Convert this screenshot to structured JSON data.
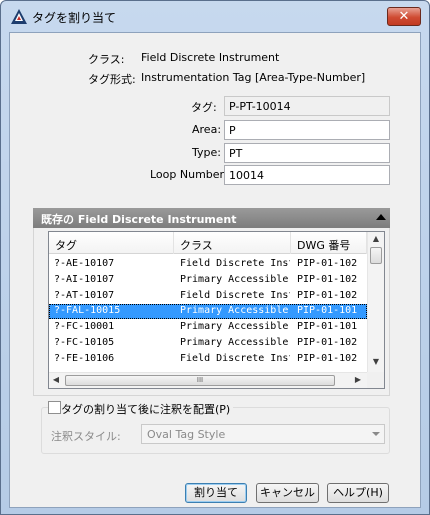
{
  "window": {
    "title": "タグを割り当て",
    "close_glyph": "✕"
  },
  "form": {
    "class_label": "クラス:",
    "class_value": "Field Discrete Instrument",
    "tag_format_label": "タグ形式:",
    "tag_format_value": "Instrumentation Tag [Area-Type-Number]",
    "tag_label": "タグ:",
    "tag_value": "P-PT-10014",
    "area_label": "Area:",
    "area_value": "P",
    "type_label": "Type:",
    "type_value": "PT",
    "loop_label": "Loop Number:",
    "loop_value": "10014"
  },
  "existing": {
    "header": "既存の Field Discrete Instrument",
    "columns": [
      "タグ",
      "クラス",
      "DWG 番号"
    ],
    "rows": [
      {
        "tag": "?-AE-10107",
        "cls": "Field Discrete Instr...",
        "dwg": "PIP-01-102",
        "selected": false
      },
      {
        "tag": "?-AI-10107",
        "cls": "Primary Accessible...",
        "dwg": "PIP-01-102",
        "selected": false
      },
      {
        "tag": "?-AT-10107",
        "cls": "Field Discrete Instr...",
        "dwg": "PIP-01-102",
        "selected": false
      },
      {
        "tag": "?-FAL-10015",
        "cls": "Primary Accessible...",
        "dwg": "PIP-01-101",
        "selected": true
      },
      {
        "tag": "?-FC-10001",
        "cls": "Primary Accessible...",
        "dwg": "PIP-01-101",
        "selected": false
      },
      {
        "tag": "?-FC-10105",
        "cls": "Primary Accessible...",
        "dwg": "PIP-01-102",
        "selected": false
      },
      {
        "tag": "?-FE-10106",
        "cls": "Field Discrete Instr...",
        "dwg": "PIP-01-102",
        "selected": false
      }
    ],
    "hscroll_thumb_glyph": "III"
  },
  "annotation": {
    "checkbox_label": "タグの割り当て後に注釈を配置(P)",
    "checked": false,
    "style_label": "注釈スタイル:",
    "style_value": "Oval Tag Style"
  },
  "buttons": {
    "assign": "割り当て",
    "cancel": "キャンセル",
    "help": "ヘルプ(H)"
  },
  "colors": {
    "selection": "#3399ff",
    "close_button": "#cf4b32",
    "group_header": "#8a8a8a"
  }
}
